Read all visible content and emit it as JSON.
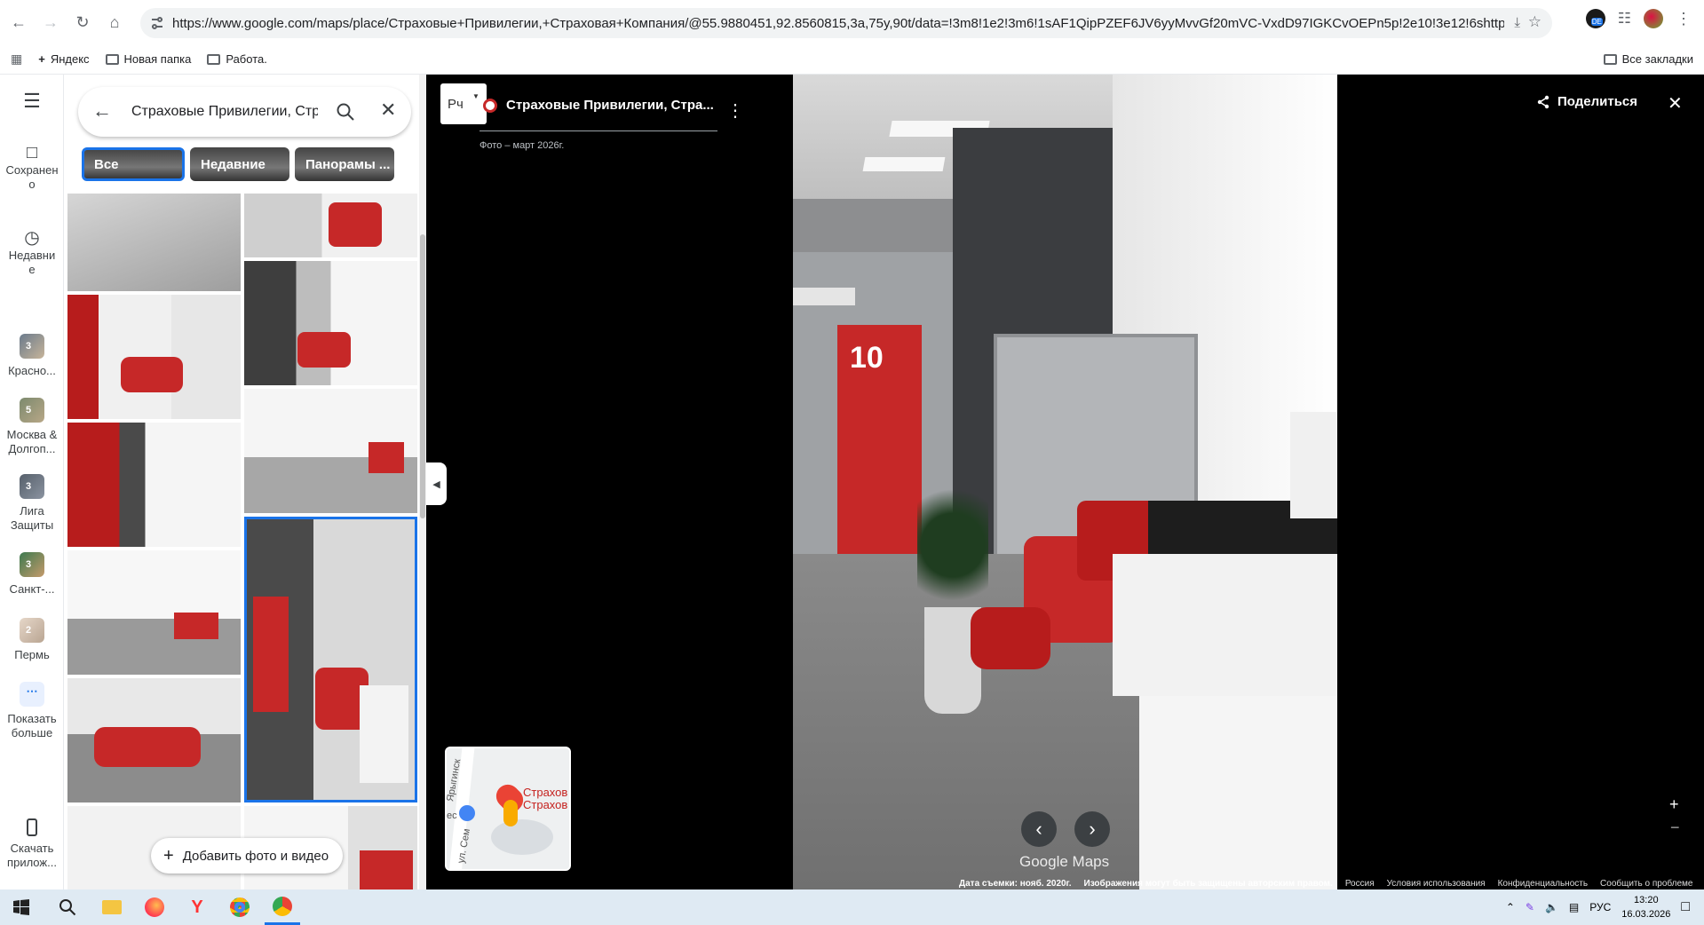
{
  "browser": {
    "url": "https://www.google.com/maps/place/Страховые+Привилегии,+Страховая+Компания/@55.9880451,92.8560815,3a,75y,90t/data=!3m8!1e2!3m6!1sAF1QipPZEF6JV6yyMvvGf20mVC-VxdD97IGKCvOEPn5p!2e10!3e12!6shttps:%2F%2Flh3.g...",
    "bookmarks": [
      "Яндекс",
      "Новая папка",
      "Работа."
    ],
    "all_bookmarks": "Все закладки",
    "profile_badge": "DE"
  },
  "rail": {
    "saved": "Сохранен о",
    "recent": "Недавни е",
    "items": [
      {
        "label": "Красно...",
        "count": "3"
      },
      {
        "label": "Москва & Долгоп...",
        "count": "5"
      },
      {
        "label": "Лига Защиты",
        "count": "3"
      },
      {
        "label": "Санкт-...",
        "count": "3"
      },
      {
        "label": "Пермь",
        "count": "2"
      }
    ],
    "more": "Показать больше",
    "app": "Скачать прилож..."
  },
  "search": {
    "query": "Страховые Привилегии, Стр"
  },
  "chips": [
    "Все",
    "Недавние",
    "Панорамы ..."
  ],
  "add_photo": "Добавить фото и видео",
  "viewer": {
    "lang": "Рч",
    "place_title": "Страховые Привилегии, Стра...",
    "photo_date": "Фото – март 2026г.",
    "share": "Поделиться",
    "watermark": "Google Maps",
    "minimap_label1": "Страхов",
    "minimap_label2": "Страхов",
    "minimap_street1": "Ярыгинск",
    "minimap_street2": "ул. Сем",
    "minimap_street3": "ес",
    "footer": [
      "Дата съемки: нояб. 2020г.",
      "Изображения могут быть защищены авторским правом.",
      "Россия",
      "Условия использования",
      "Конфиденциальность",
      "Сообщить о проблеме"
    ]
  },
  "taskbar": {
    "lang": "РУС",
    "time": "13:20",
    "date": "16.03.2026"
  },
  "colors": {
    "accent": "#1a73e8",
    "brand_red": "#c62828"
  }
}
